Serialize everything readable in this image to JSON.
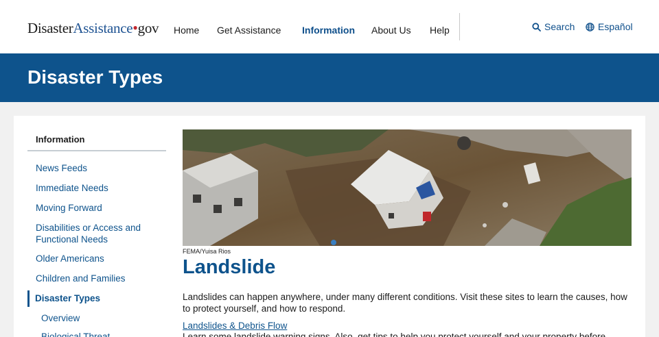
{
  "header": {
    "logo": {
      "part1": "Disaster",
      "part2": "Assistance",
      "dot": "•",
      "part3": "gov"
    },
    "nav": [
      {
        "label": "Home",
        "active": false
      },
      {
        "label": "Get Assistance",
        "active": false
      },
      {
        "label": "Information",
        "active": true
      },
      {
        "label": "About Us",
        "active": false
      },
      {
        "label": "Help",
        "active": false
      }
    ],
    "search": {
      "label": "Search",
      "icon": "search-icon"
    },
    "language": {
      "label": "Español",
      "icon": "globe-icon"
    }
  },
  "banner": {
    "title": "Disaster Types"
  },
  "sidebar": {
    "heading": "Information",
    "items": [
      {
        "label": "News Feeds"
      },
      {
        "label": "Immediate Needs"
      },
      {
        "label": "Moving Forward"
      },
      {
        "label": "Disabilities or Access and Functional Needs"
      },
      {
        "label": "Older Americans"
      },
      {
        "label": "Children and Families"
      },
      {
        "label": "Disaster Types",
        "active": true
      }
    ],
    "subitems": [
      {
        "label": "Overview"
      },
      {
        "label": "Biological Threat"
      }
    ]
  },
  "main": {
    "image_credit": "FEMA/Yuisa Rios",
    "heading": "Landslide",
    "paragraph": "Landslides can happen anywhere, under many different conditions. Visit these sites to learn the causes, how to protect yourself, and how to respond.",
    "link": "Landslides & Debris Flow",
    "paragraph2": "Learn some landslide warning signs. Also, get tips to help you protect yourself and your property before,"
  },
  "colors": {
    "brand_blue": "#0e538c",
    "logo_red": "#c1272d",
    "page_bg": "#f1f1f1"
  }
}
